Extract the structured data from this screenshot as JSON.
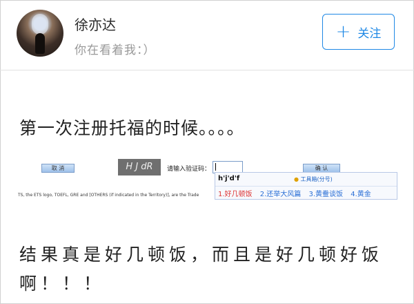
{
  "post": {
    "author": "徐亦达",
    "subtitle": "你在看着我：）",
    "follow_label": "关注",
    "text_1": "第一次注册托福的时候。。。。",
    "text_2": "结果真是好几顿饭，而且是好几顿好饭啊！！！"
  },
  "screenshot": {
    "cancel_label": "取 消",
    "confirm_label": "确 认",
    "captcha_text": "H J dR",
    "captcha_prompt": "请输入验证码：",
    "legal_text": "TS, the ETS logo, TOEFL, GRE and [OTHERS (if indicated in the Territory)], are the Trade",
    "ime": {
      "pinyin": "h'j'd'f",
      "toolbox": "工具箱(分号)",
      "candidates": [
        "1.好几顿饭",
        "2.还举大风篇",
        "3.黄鲞谈饭",
        "4.黄金"
      ]
    }
  },
  "colors": {
    "accent": "#1e88e5",
    "ime_first": "#d33333",
    "ime_other": "#2a6fd6"
  },
  "icons": {
    "follow": "plus-icon",
    "toolbox": "lightbulb-icon"
  }
}
